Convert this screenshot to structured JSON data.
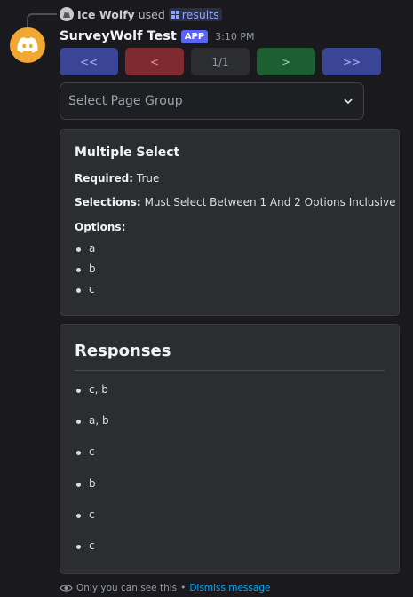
{
  "reply": {
    "username": "Ice Wolfy",
    "used_text": "used",
    "command": "results"
  },
  "message": {
    "bot_name": "SurveyWolf Test",
    "app_tag": "APP",
    "timestamp": "3:10 PM"
  },
  "buttons": [
    {
      "label": "<<",
      "style": "blurple"
    },
    {
      "label": "<",
      "style": "red"
    },
    {
      "label": "1/1",
      "style": "gray"
    },
    {
      "label": ">",
      "style": "green"
    },
    {
      "label": ">>",
      "style": "blurple"
    }
  ],
  "select": {
    "placeholder": "Select Page Group"
  },
  "question_embed": {
    "title": "Multiple Select",
    "required_label": "Required:",
    "required_value": "True",
    "selections_label": "Selections:",
    "selections_value": "Must Select Between 1 And 2 Options Inclusive",
    "options_label": "Options:",
    "options": [
      "a",
      "b",
      "c"
    ]
  },
  "responses_embed": {
    "title": "Responses",
    "responses": [
      "c, b",
      "a, b",
      "c",
      "b",
      "c",
      "c"
    ]
  },
  "footer": {
    "ephemeral_text": "Only you can see this",
    "separator": "•",
    "dismiss_text": "Dismiss message"
  },
  "colors": {
    "background": "#1a1a1e",
    "embed_bg": "#2b2d31",
    "blurple": "#3a4596",
    "red": "#7e2a30",
    "green": "#1e5e33",
    "app_tag": "#5865f2",
    "avatar": "#f0a832",
    "link": "#00a8fc"
  }
}
